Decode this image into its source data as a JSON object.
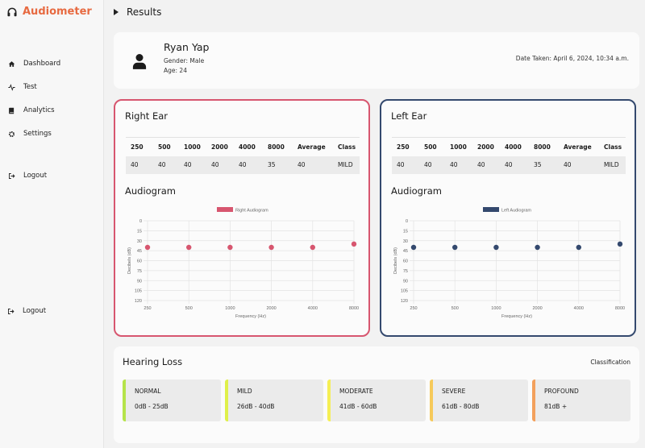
{
  "app": {
    "name": "Audiometer",
    "brand_color": "#e76a41"
  },
  "sidebar": {
    "items": [
      {
        "label": "Dashboard",
        "icon": "home-icon"
      },
      {
        "label": "Test",
        "icon": "waveform-icon"
      },
      {
        "label": "Analytics",
        "icon": "book-icon"
      },
      {
        "label": "Settings",
        "icon": "gear-icon"
      },
      {
        "label": "Logout",
        "icon": "logout-icon"
      }
    ],
    "bottom_logout": "Logout"
  },
  "header": {
    "title": "Results"
  },
  "patient": {
    "name": "Ryan Yap",
    "gender": "Gender: Male",
    "age": "Age: 24",
    "date_taken": "Date Taken: April 6, 2024, 10:34 a.m."
  },
  "right_ear": {
    "title": "Right Ear",
    "color": "#d7566f",
    "columns": [
      "250",
      "500",
      "1000",
      "2000",
      "4000",
      "8000",
      "Average",
      "Class"
    ],
    "values": [
      "40",
      "40",
      "40",
      "40",
      "40",
      "35",
      "40",
      "MILD"
    ],
    "audiogram_title": "Audiogram",
    "legend": "Right Audiogram"
  },
  "left_ear": {
    "title": "Left Ear",
    "color": "#34496e",
    "columns": [
      "250",
      "500",
      "1000",
      "2000",
      "4000",
      "8000",
      "Average",
      "Class"
    ],
    "values": [
      "40",
      "40",
      "40",
      "40",
      "40",
      "35",
      "40",
      "MILD"
    ],
    "audiogram_title": "Audiogram",
    "legend": "Left Audiogram"
  },
  "chart_data": [
    {
      "type": "scatter",
      "x": [
        "250",
        "500",
        "1000",
        "2000",
        "4000",
        "8000"
      ],
      "series": [
        {
          "name": "Right Audiogram",
          "values": [
            40,
            40,
            40,
            40,
            40,
            35
          ],
          "color": "#d7566f"
        }
      ],
      "ylabel": "Decibels (dB)",
      "xlabel": "Frequency (Hz)",
      "yticks": [
        "0",
        "15",
        "30",
        "45",
        "60",
        "75",
        "90",
        "105",
        "120"
      ],
      "ylim": [
        0,
        120
      ],
      "y_inverted": true,
      "grid": true,
      "legend_position": "top-center"
    },
    {
      "type": "scatter",
      "x": [
        "250",
        "500",
        "1000",
        "2000",
        "4000",
        "8000"
      ],
      "series": [
        {
          "name": "Left Audiogram",
          "values": [
            40,
            40,
            40,
            40,
            40,
            35
          ],
          "color": "#34496e"
        }
      ],
      "ylabel": "Decibels (dB)",
      "xlabel": "Frequency (Hz)",
      "yticks": [
        "0",
        "15",
        "30",
        "45",
        "60",
        "75",
        "90",
        "105",
        "120"
      ],
      "ylim": [
        0,
        120
      ],
      "y_inverted": true,
      "grid": true,
      "legend_position": "top-center"
    }
  ],
  "hearing_loss": {
    "title": "Hearing Loss",
    "classification_label": "Classification",
    "classes": [
      {
        "name": "NORMAL",
        "range": "0dB - 25dB",
        "color": "#b5e34a"
      },
      {
        "name": "MILD",
        "range": "26dB - 40dB",
        "color": "#dff04a"
      },
      {
        "name": "MODERATE",
        "range": "41dB - 60dB",
        "color": "#f5ef54"
      },
      {
        "name": "SEVERE",
        "range": "61dB - 80dB",
        "color": "#f6c95a"
      },
      {
        "name": "PROFOUND",
        "range": "81dB +",
        "color": "#f3a05c"
      }
    ]
  }
}
